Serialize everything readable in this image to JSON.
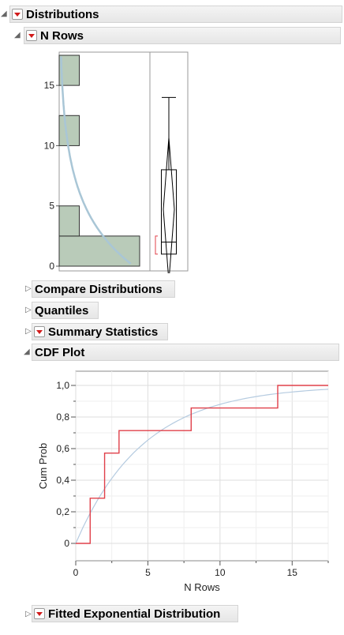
{
  "distributions": {
    "title": "Distributions"
  },
  "n_rows_section": {
    "title": "N Rows",
    "histogram_ticks": [
      "0",
      "5",
      "10",
      "15"
    ]
  },
  "collapsed_sections": {
    "compare": "Compare Distributions",
    "quantiles": "Quantiles",
    "summary": "Summary Statistics"
  },
  "cdf_section": {
    "title": "CDF Plot"
  },
  "fitted_section": {
    "title": "Fitted Exponential Distribution"
  },
  "colors": {
    "bar_fill": "#b9cbb9",
    "bar_stroke": "#333333",
    "density_curve": "#a9c6d6",
    "cdf_step": "#e0404a",
    "cdf_fit": "#b5cbe0",
    "header_bg": "#ececec"
  },
  "chart_data": [
    {
      "type": "bar",
      "orientation": "horizontal",
      "bins": [
        {
          "from": 0,
          "to": 2.5,
          "count": 4
        },
        {
          "from": 2.5,
          "to": 5,
          "count": 1
        },
        {
          "from": 10,
          "to": 12.5,
          "count": 1
        },
        {
          "from": 15,
          "to": 17.5,
          "count": 1
        }
      ],
      "ylim": [
        0,
        17.5
      ],
      "y_ticks": [
        0,
        5,
        10,
        15
      ],
      "boxplot": {
        "min": 1,
        "q1": 1,
        "median": 2,
        "q3": 8,
        "max": 14,
        "mean": 4.714
      },
      "fitted_curve": "exponential"
    },
    {
      "type": "line",
      "xlabel": "N Rows",
      "ylabel": "Cum Prob",
      "xlim": [
        0,
        17.5
      ],
      "ylim": [
        0,
        1
      ],
      "x_ticks": [
        "0",
        "5",
        "10",
        "15"
      ],
      "y_ticks": [
        "0",
        "0,2",
        "0,4",
        "0,6",
        "0,8",
        "1,0"
      ],
      "grid": true,
      "series": [
        {
          "type": "step",
          "x": [
            0,
            1,
            2,
            3,
            8,
            14,
            17.5
          ],
          "y": [
            0,
            0.2857,
            0.5714,
            0.7143,
            0.8571,
            1.0,
            1.0
          ]
        },
        {
          "type": "fitted-exponential",
          "mean": 4.714
        }
      ]
    }
  ]
}
